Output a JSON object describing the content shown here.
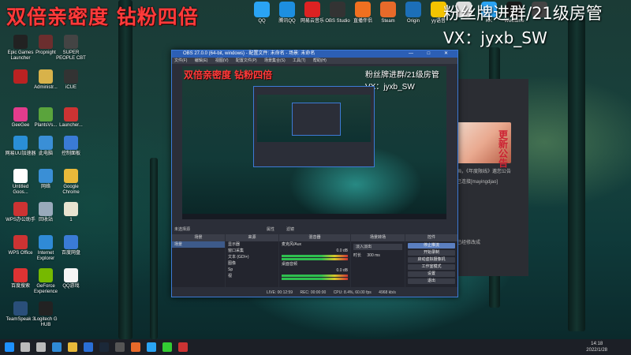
{
  "overlay": {
    "left_text": "双倍亲密度 钻粉四倍",
    "right_line1": "粉丝牌进群/21级房管",
    "right_line2": "VX：jyxb_SW"
  },
  "desktop_icons": {
    "left": [
      {
        "label": "Epic Games Launcher",
        "color": "#222"
      },
      {
        "label": "Propnight",
        "color": "#6b2e2e"
      },
      {
        "label": "SUPER PEOPLE CBT",
        "color": "#444"
      },
      {
        "label": "",
        "color": "#b22"
      },
      {
        "label": "Administr...",
        "color": "#d8b24a"
      },
      {
        "label": "iCUE",
        "color": "#333"
      },
      {
        "label": "GeeGee",
        "color": "#e23c8c"
      },
      {
        "label": "PlantsVs...",
        "color": "#5aa43c"
      },
      {
        "label": "Launcher...",
        "color": "#c33"
      },
      {
        "label": "网易UU加速器",
        "color": "#2a8fd6"
      },
      {
        "label": "此电脑",
        "color": "#3a8fd6"
      },
      {
        "label": "控制面板",
        "color": "#3a7bd6"
      },
      {
        "label": "Untitled Goos...",
        "color": "#fff"
      },
      {
        "label": "网络",
        "color": "#3a8fd6"
      },
      {
        "label": "Google Chrome",
        "color": "#e8b93a"
      },
      {
        "label": "WPS办公助手",
        "color": "#c33"
      },
      {
        "label": "回收站",
        "color": "#9ab"
      },
      {
        "label": "1",
        "color": "#e8e3d0"
      },
      {
        "label": "WPS Office",
        "color": "#c33"
      },
      {
        "label": "Internet Explorer",
        "color": "#2f8ad6"
      },
      {
        "label": "百度网盘",
        "color": "#3a7bd6"
      },
      {
        "label": "百度搜索",
        "color": "#d33"
      },
      {
        "label": "GeForce Experience",
        "color": "#76b900"
      },
      {
        "label": "QQ游戏",
        "color": "#f5f5f5"
      },
      {
        "label": "TeamSpeak 3",
        "color": "#2a4f7a"
      },
      {
        "label": "Logitech G HUB",
        "color": "#222"
      }
    ],
    "top": [
      {
        "label": "QQ",
        "color": "#2aa4f4"
      },
      {
        "label": "腾讯QQ",
        "color": "#1d8fe0"
      },
      {
        "label": "网易云音乐",
        "color": "#d22"
      },
      {
        "label": "OBS Studio",
        "color": "#333"
      },
      {
        "label": "直播伴侣",
        "color": "#f07020"
      },
      {
        "label": "Steam",
        "color": "#e86a2a"
      },
      {
        "label": "Origin",
        "color": "#1c6fb8"
      },
      {
        "label": "yy语音",
        "color": "#f4c400"
      },
      {
        "label": "",
        "color": "#ddd"
      },
      {
        "label": "KK",
        "color": "#2aa4f4"
      },
      {
        "label": "WeGame",
        "color": "#1a1a1a"
      },
      {
        "label": "",
        "color": "#444"
      }
    ]
  },
  "obs": {
    "title": "OBS 27.0.0 (64-bit, windows) - 配置文件: 未命名 - 场景: 未命名",
    "menu": [
      "文件(F)",
      "编辑(E)",
      "视图(V)",
      "配置文件(P)",
      "场景集合(S)",
      "工具(T)",
      "帮助(H)"
    ],
    "window_buttons": "— □ ✕",
    "stage_label": "未选择源",
    "stage_buttons": [
      "属性",
      "滤镜"
    ],
    "panels": {
      "scenes": {
        "title": "场景",
        "items": [
          "场景"
        ]
      },
      "sources": {
        "title": "来源",
        "items": [
          "显示器",
          "窗口采集",
          "文本 (GDI+)",
          "图像",
          "Sp",
          "视"
        ]
      },
      "mixer": {
        "title": "混音器",
        "channels": [
          {
            "name": "麦克风/Aux",
            "level": "0.0 dB"
          },
          {
            "name": "桌面音频",
            "level": "0.0 dB"
          }
        ]
      },
      "transitions": {
        "title": "场景转场",
        "type": "淡入淡出",
        "duration_label": "时长",
        "duration": "300 ms"
      },
      "controls": {
        "title": "控件",
        "buttons": [
          "停止推流",
          "开始录制",
          "启动虚拟摄像机",
          "工作室模式",
          "设置",
          "退出"
        ]
      }
    },
    "status": {
      "live": "LIVE: 00:12:59",
      "rec": "REC: 00:00:00",
      "cpu": "CPU: 8.4%, 60.00 fps",
      "kbps": "4968 kb/s"
    }
  },
  "background_window": {
    "text_lines": [
      "画，《年度限线》邀您公告",
      "已连接[mayingdjao]",
      "已经修改成"
    ],
    "card_text": "更新公告"
  },
  "taskbar": {
    "time": "14:18",
    "date": "2022/1/28",
    "icons": [
      "start",
      "search",
      "task-view",
      "edge",
      "explorer",
      "store",
      "steam",
      "obs",
      "app",
      "mail",
      "chat",
      "media"
    ]
  },
  "colors": {
    "overlay_red": "#ff3b3b",
    "obs_accent": "#3d7ad6",
    "taskbar": "#1c1f26"
  }
}
